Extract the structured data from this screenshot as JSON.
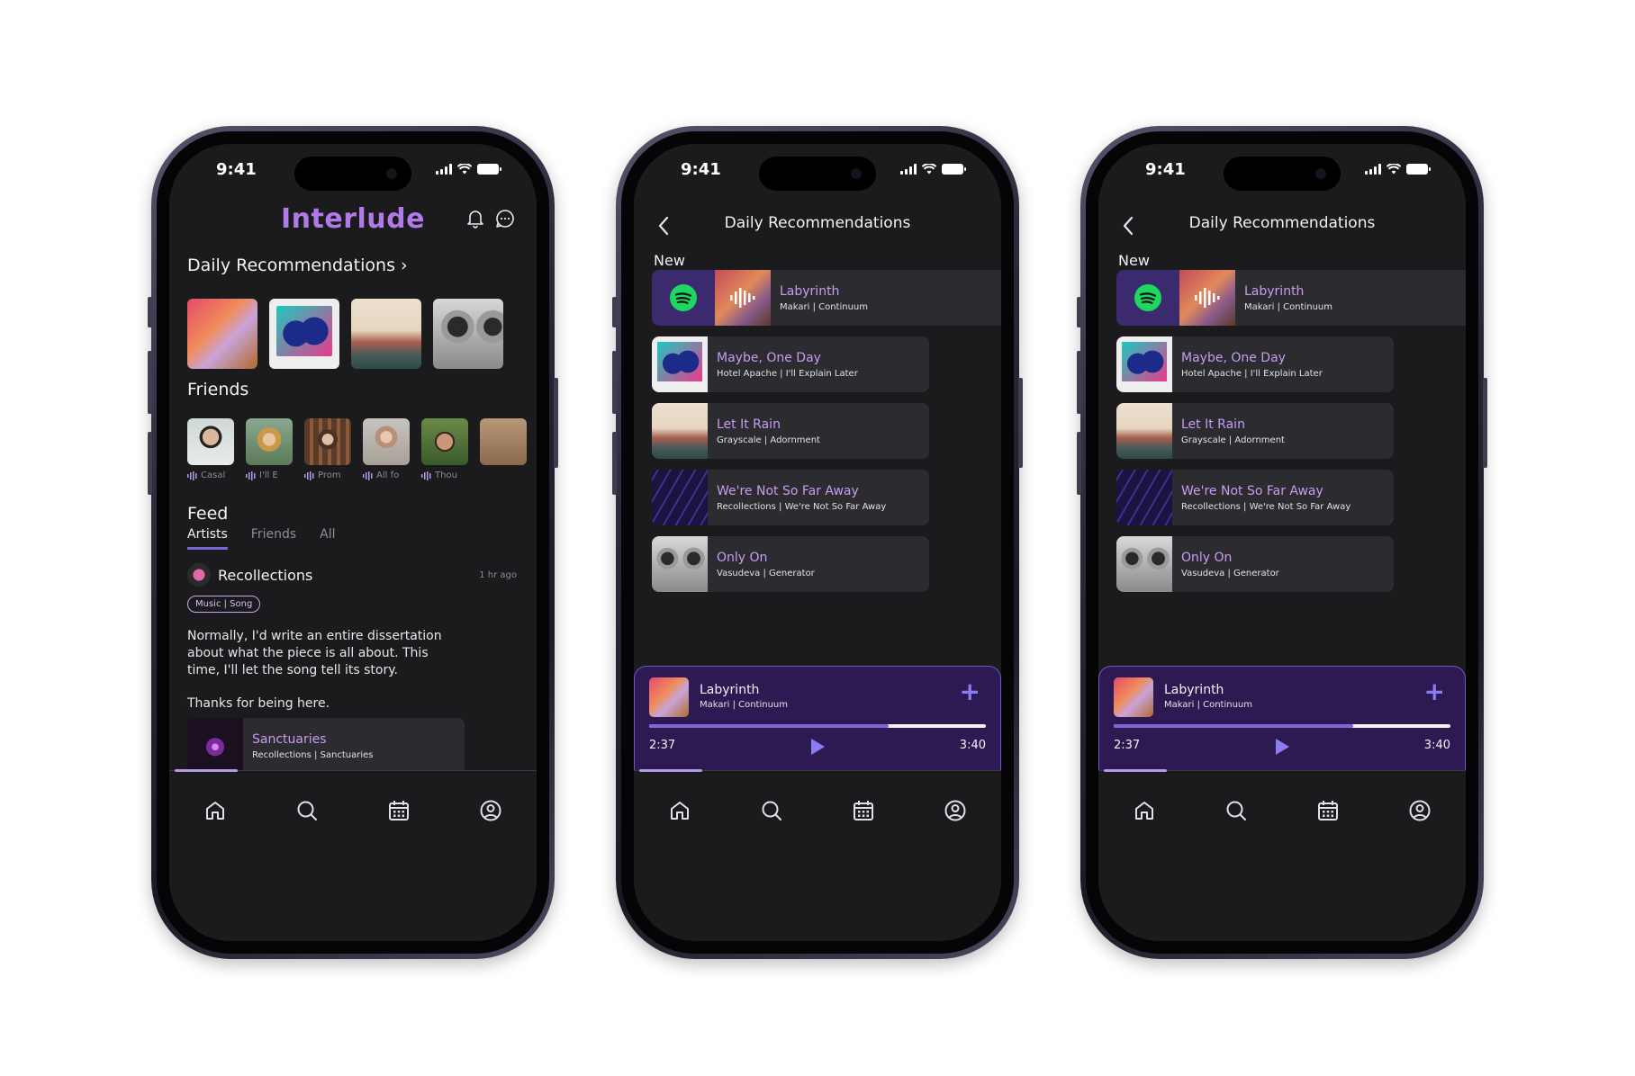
{
  "status": {
    "time": "9:41"
  },
  "home": {
    "logo": "Interlude",
    "reco_title": "Daily Recommendations",
    "reco_chevron": "›",
    "friends_title": "Friends",
    "friends": [
      {
        "song": "Casal"
      },
      {
        "song": "I'll E"
      },
      {
        "song": "Prom"
      },
      {
        "song": "All fo"
      },
      {
        "song": "Thou"
      }
    ],
    "feed_title": "Feed",
    "feed_tabs": [
      "Artists",
      "Friends",
      "All"
    ],
    "post": {
      "author": "Recollections",
      "time": "1 hr ago",
      "chip": "Music | Song",
      "body": "Normally, I'd write an entire dissertation about what the piece is all about. This time, I'll let the song tell its story.",
      "thanks": "Thanks for being here.",
      "song_title": "Sanctuaries",
      "song_sub": "Recollections | Sanctuaries"
    }
  },
  "recommendations": {
    "title": "Daily Recommendations",
    "section": "New",
    "tracks": [
      {
        "title": "Labyrinth",
        "sub": "Makari | Continuum"
      },
      {
        "title": "Maybe, One Day",
        "sub": "Hotel Apache | I'll Explain Later"
      },
      {
        "title": "Let It Rain",
        "sub": "Grayscale | Adornment"
      },
      {
        "title": "We're Not So Far Away",
        "sub": "Recollections | We're Not So Far Away"
      },
      {
        "title": "Only On",
        "sub": "Vasudeva | Generator"
      }
    ]
  },
  "player": {
    "title": "Labyrinth",
    "sub": "Makari | Continuum",
    "current": "2:37",
    "total": "3:40",
    "plus": "+",
    "progress_fraction": 0.71
  },
  "nav": {
    "items": [
      "home-icon",
      "search-icon",
      "calendar-icon",
      "profile-icon"
    ]
  },
  "colors": {
    "accent": "#7b68d8",
    "brand": "#b07ae8",
    "title_purple": "#c79cf1",
    "player_bg": "#2e1a52",
    "spotify": "#1ed760"
  }
}
